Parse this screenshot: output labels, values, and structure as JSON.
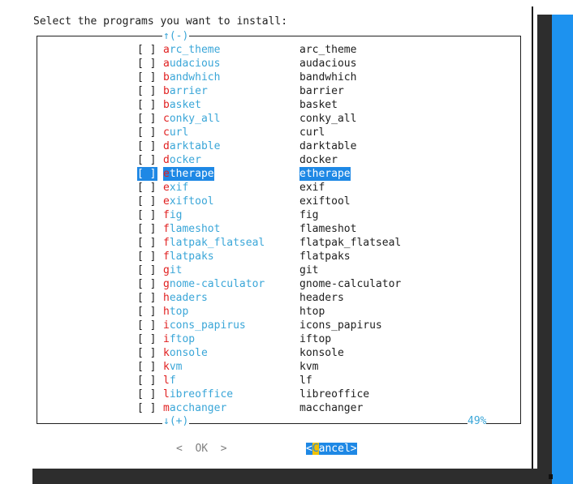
{
  "prompt": "Select the programs you want to install:",
  "scroll": {
    "top_indicator": "↑(-)",
    "bottom_indicator": "↓(+)",
    "percent": "49%"
  },
  "items": [
    {
      "checkbox": "[ ]",
      "tag_first": "a",
      "tag_rest": "rc_theme",
      "desc": "arc_theme",
      "selected": false
    },
    {
      "checkbox": "[ ]",
      "tag_first": "a",
      "tag_rest": "udacious",
      "desc": "audacious",
      "selected": false
    },
    {
      "checkbox": "[ ]",
      "tag_first": "b",
      "tag_rest": "andwhich",
      "desc": "bandwhich",
      "selected": false
    },
    {
      "checkbox": "[ ]",
      "tag_first": "b",
      "tag_rest": "arrier",
      "desc": "barrier",
      "selected": false
    },
    {
      "checkbox": "[ ]",
      "tag_first": "b",
      "tag_rest": "asket",
      "desc": "basket",
      "selected": false
    },
    {
      "checkbox": "[ ]",
      "tag_first": "c",
      "tag_rest": "onky_all",
      "desc": "conky_all",
      "selected": false
    },
    {
      "checkbox": "[ ]",
      "tag_first": "c",
      "tag_rest": "url",
      "desc": "curl",
      "selected": false
    },
    {
      "checkbox": "[ ]",
      "tag_first": "d",
      "tag_rest": "arktable",
      "desc": "darktable",
      "selected": false
    },
    {
      "checkbox": "[ ]",
      "tag_first": "d",
      "tag_rest": "ocker",
      "desc": "docker",
      "selected": false
    },
    {
      "checkbox": "[ ]",
      "tag_first": "e",
      "tag_rest": "therape",
      "desc": "etherape",
      "selected": true
    },
    {
      "checkbox": "[ ]",
      "tag_first": "e",
      "tag_rest": "xif",
      "desc": "exif",
      "selected": false
    },
    {
      "checkbox": "[ ]",
      "tag_first": "e",
      "tag_rest": "xiftool",
      "desc": "exiftool",
      "selected": false
    },
    {
      "checkbox": "[ ]",
      "tag_first": "f",
      "tag_rest": "ig",
      "desc": "fig",
      "selected": false
    },
    {
      "checkbox": "[ ]",
      "tag_first": "f",
      "tag_rest": "lameshot",
      "desc": "flameshot",
      "selected": false
    },
    {
      "checkbox": "[ ]",
      "tag_first": "f",
      "tag_rest": "latpak_flatseal",
      "desc": "flatpak_flatseal",
      "selected": false
    },
    {
      "checkbox": "[ ]",
      "tag_first": "f",
      "tag_rest": "latpaks",
      "desc": "flatpaks",
      "selected": false
    },
    {
      "checkbox": "[ ]",
      "tag_first": "g",
      "tag_rest": "it",
      "desc": "git",
      "selected": false
    },
    {
      "checkbox": "[ ]",
      "tag_first": "g",
      "tag_rest": "nome-calculator",
      "desc": "gnome-calculator",
      "selected": false
    },
    {
      "checkbox": "[ ]",
      "tag_first": "h",
      "tag_rest": "eaders",
      "desc": "headers",
      "selected": false
    },
    {
      "checkbox": "[ ]",
      "tag_first": "h",
      "tag_rest": "top",
      "desc": "htop",
      "selected": false
    },
    {
      "checkbox": "[ ]",
      "tag_first": "i",
      "tag_rest": "cons_papirus",
      "desc": "icons_papirus",
      "selected": false
    },
    {
      "checkbox": "[ ]",
      "tag_first": "i",
      "tag_rest": "ftop",
      "desc": "iftop",
      "selected": false
    },
    {
      "checkbox": "[ ]",
      "tag_first": "k",
      "tag_rest": "onsole",
      "desc": "konsole",
      "selected": false
    },
    {
      "checkbox": "[ ]",
      "tag_first": "k",
      "tag_rest": "vm",
      "desc": "kvm",
      "selected": false
    },
    {
      "checkbox": "[ ]",
      "tag_first": "l",
      "tag_rest": "f",
      "desc": "lf",
      "selected": false
    },
    {
      "checkbox": "[ ]",
      "tag_first": "l",
      "tag_rest": "ibreoffice",
      "desc": "libreoffice",
      "selected": false
    },
    {
      "checkbox": "[ ]",
      "tag_first": "m",
      "tag_rest": "acchanger",
      "desc": "macchanger",
      "selected": false
    }
  ],
  "buttons": {
    "ok": {
      "label": "<  OK  >"
    },
    "cancel": {
      "left": "<",
      "hot": "C",
      "rest": "ancel>"
    }
  },
  "colors": {
    "terminal_bg": "#1d92ef",
    "selection": "#1e88e5",
    "hotkey": "#e02020",
    "tag_text": "#3aa6d8",
    "button_hotkey": "#f0c000"
  }
}
